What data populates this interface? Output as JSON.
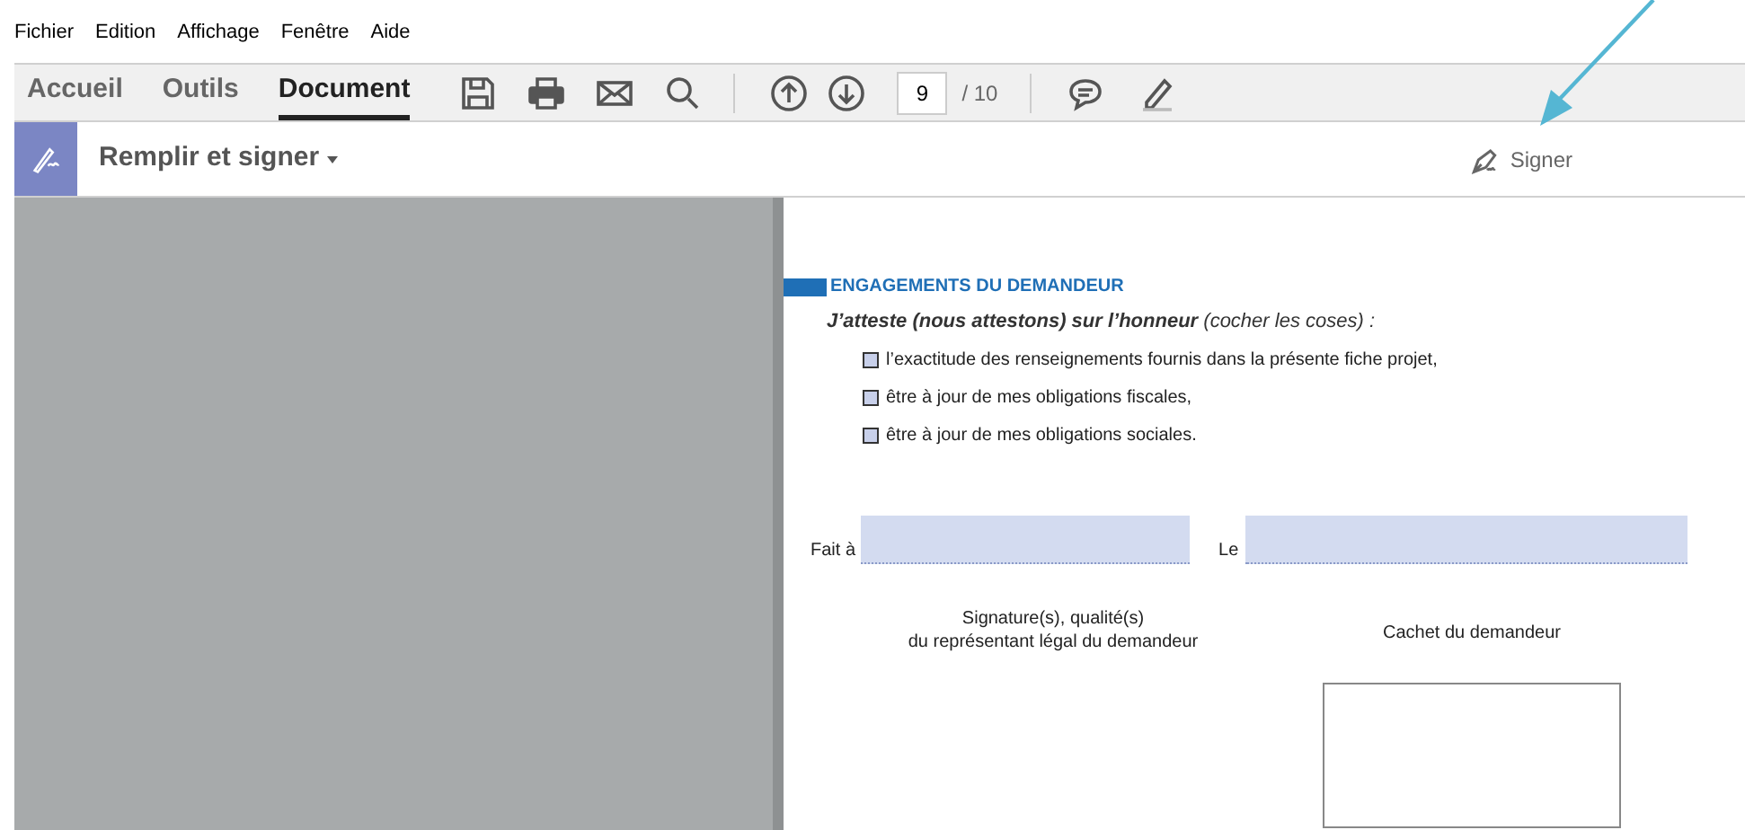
{
  "menu": [
    "Fichier",
    "Edition",
    "Affichage",
    "Fenêtre",
    "Aide"
  ],
  "tabs": [
    {
      "label": "Accueil",
      "selected": false
    },
    {
      "label": "Outils",
      "selected": false
    },
    {
      "label": "Document",
      "selected": true
    }
  ],
  "page_nav": {
    "current": "9",
    "total": "/ 10"
  },
  "tool_bar": {
    "title": "Remplir et signer",
    "sign_label": "Signer"
  },
  "form": {
    "section_title": "ENGAGEMENTS DU DEMANDEUR",
    "intro": "**J’atteste (nous attestons) sur l’honneur** (cocher les coses) :",
    "items": [
      {
        "label": "l’exactitude des renseignements fournis dans la présente fiche projet,",
        "checked": false
      },
      {
        "label": "être à jour de mes obligations fiscales,",
        "checked": false
      },
      {
        "label": "être à jour de mes obligations sociales.",
        "checked": false
      }
    ],
    "place_label": "Fait à",
    "date_label": "Le",
    "signature_label": "Signature(s), qualité(s)\ndu représentant légal du demandeur",
    "stamp_label": "Cachet du demandeur"
  }
}
